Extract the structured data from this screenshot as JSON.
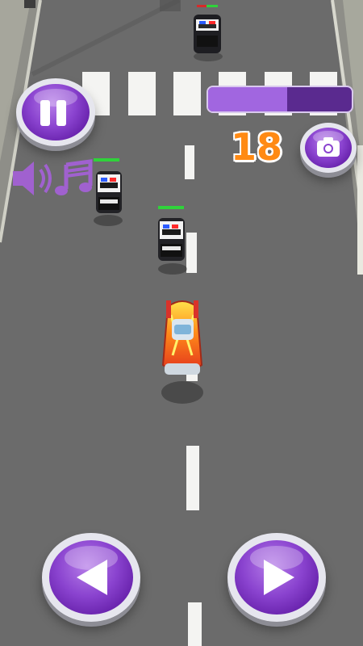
{
  "hud": {
    "score": "18",
    "progress_fraction": 0.55,
    "pause_icon": "pause-icon",
    "sound_icon": "speaker-icon",
    "music_icon": "music-note-icon",
    "camera_icon": "camera-icon"
  },
  "controls": {
    "left_icon": "left-arrow-icon",
    "right_icon": "right-arrow-icon"
  },
  "colors": {
    "accent": "#8a43cf",
    "score": "#ff8a14",
    "road": "#6a6a6a",
    "health": "#2fd23a",
    "health_low": "#d62a2a"
  },
  "vehicles": {
    "player": "flame-hot-rod",
    "police_cars": 3
  }
}
